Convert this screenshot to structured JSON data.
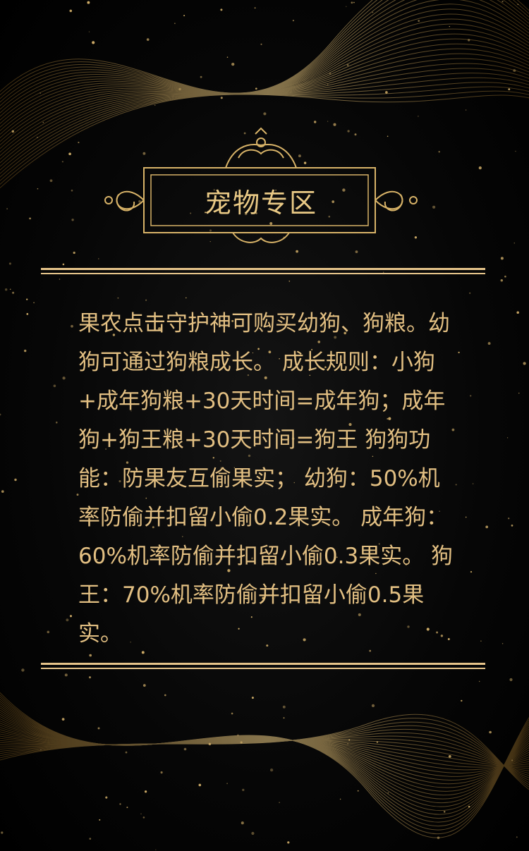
{
  "section": {
    "title": "宠物专区",
    "description": "果农点击守护神可购买幼狗、狗粮。幼狗可通过狗粮成长。 成长规则：小狗+成年狗粮+30天时间=成年狗；成年狗+狗王粮+30天时间=狗王 狗狗功能：防果友互偷果实； 幼狗：50%机率防偷并扣留小偷0.2果实。 成年狗：60%机率防偷并扣留小偷0.3果实。 狗王：70%机率防偷并扣留小偷0.5果实。"
  },
  "colors": {
    "background": "#000000",
    "gold": "#e6c48a"
  }
}
